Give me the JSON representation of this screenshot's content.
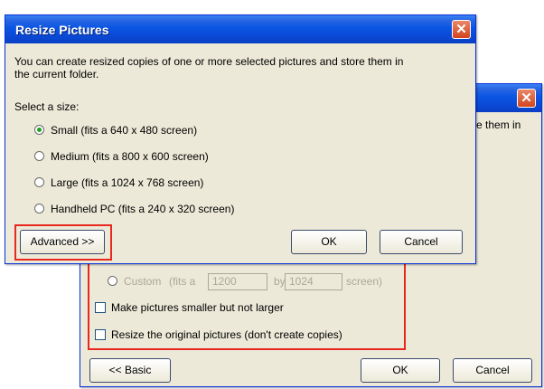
{
  "back_dialog": {
    "close_symbol": "✕",
    "partial_text": "e them in",
    "custom_label": "Custom",
    "custom_fits": "(fits a",
    "custom_width": "1200",
    "custom_by": "by",
    "custom_height": "1024",
    "custom_screen": "screen)",
    "smaller_label": "Make pictures smaller but not larger",
    "original_label": "Resize the original pictures (don't create copies)",
    "basic_button": "<< Basic",
    "ok_button": "OK",
    "cancel_button": "Cancel"
  },
  "front_dialog": {
    "title": "Resize Pictures",
    "close_symbol": "✕",
    "description_line1": "You can create resized copies of one or more selected pictures and store them in",
    "description_line2": "the current folder.",
    "select_label": "Select a size:",
    "sizes": [
      {
        "label": "Small (fits a 640 x 480 screen)",
        "checked": true
      },
      {
        "label": "Medium (fits a 800 x 600 screen)",
        "checked": false
      },
      {
        "label": "Large (fits a 1024 x 768 screen)",
        "checked": false
      },
      {
        "label": "Handheld PC (fits a 240 x 320 screen)",
        "checked": false
      }
    ],
    "advanced_button": "Advanced >>",
    "ok_button": "OK",
    "cancel_button": "Cancel"
  },
  "colors": {
    "highlight": "#e8281f",
    "title_bar": "#0a55e3",
    "dialog_face": "#ece9d8"
  }
}
